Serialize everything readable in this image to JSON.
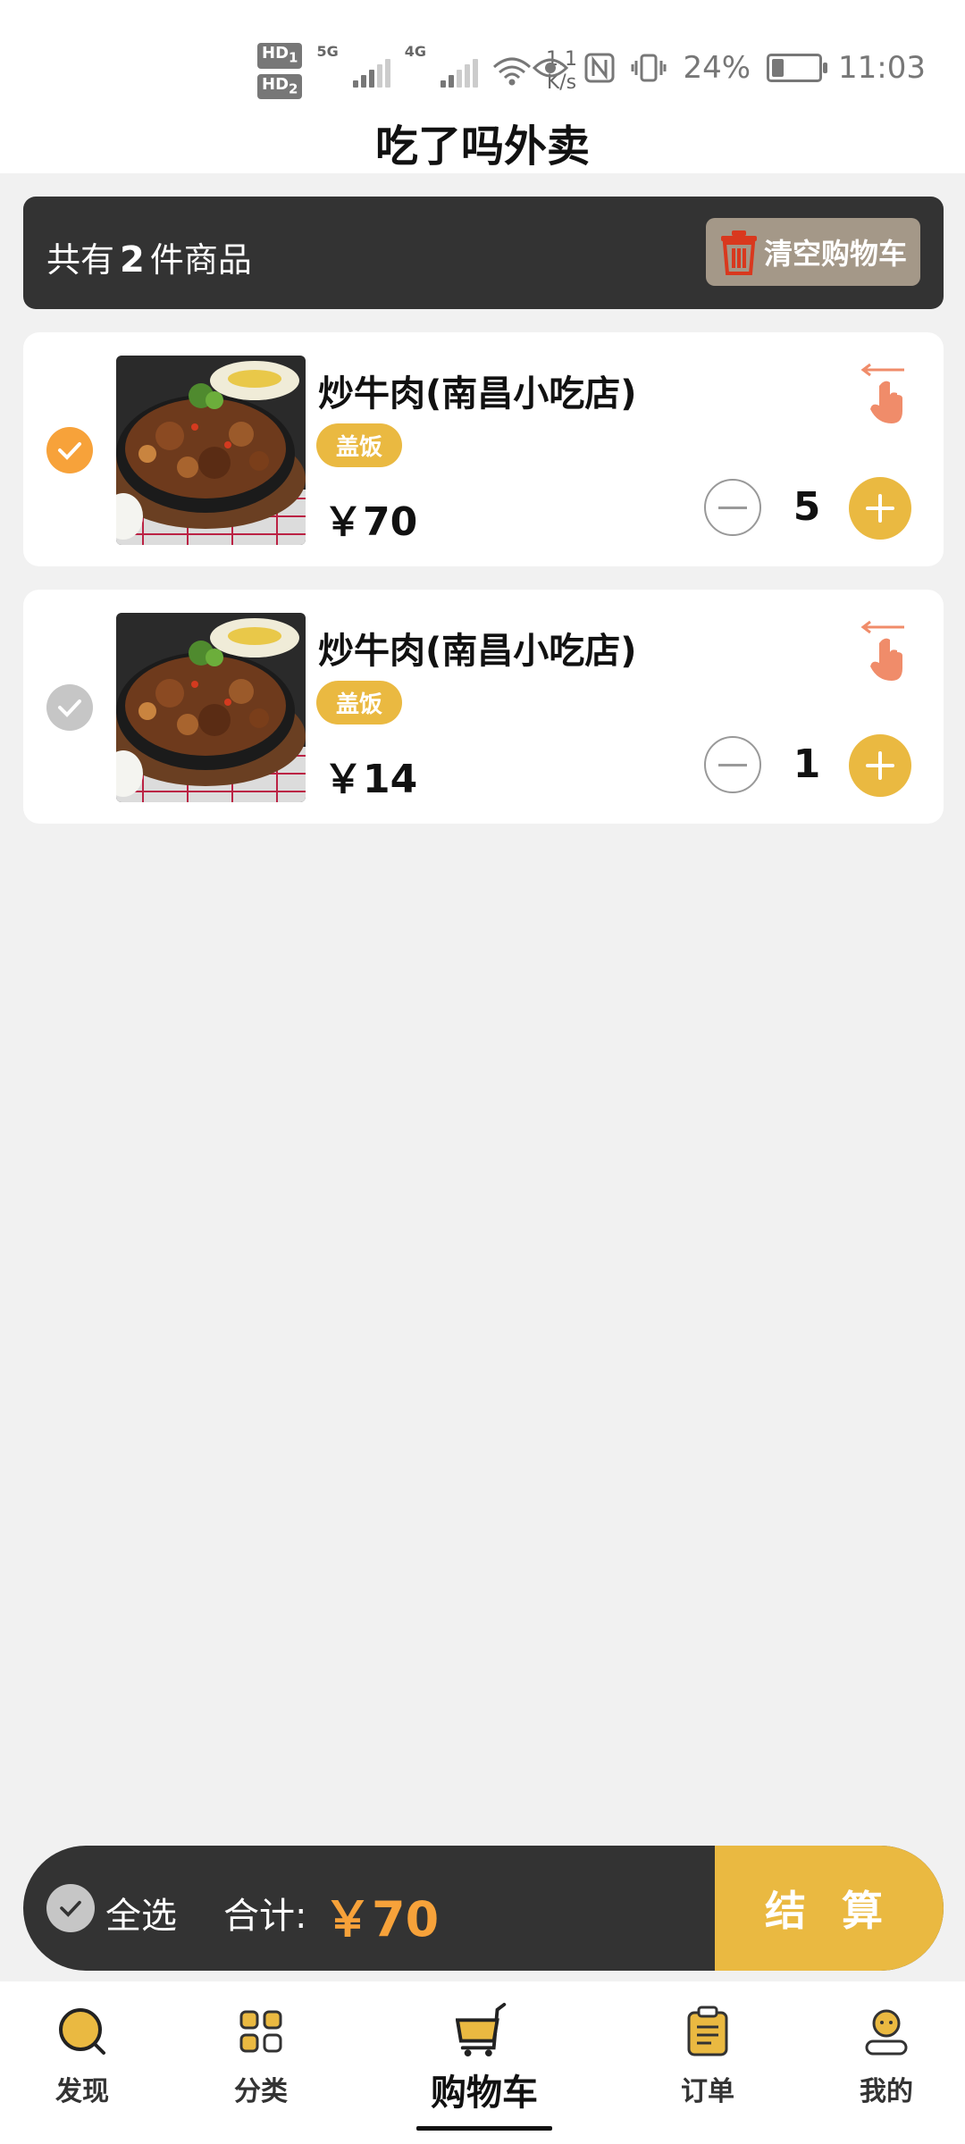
{
  "status_bar": {
    "hd1": "HD",
    "hd1_sub": "1",
    "hd2": "HD",
    "hd2_sub": "2",
    "net1": "5G",
    "net2": "4G",
    "speed_value": "1.1",
    "speed_unit": "K/s",
    "battery": "24%",
    "battery_level": 0.24,
    "time": "11:03"
  },
  "app": {
    "title": "吃了吗外卖"
  },
  "summary": {
    "prefix": "共有",
    "count": "2",
    "suffix": "件商品",
    "clear_label": "清空购物车"
  },
  "cart": {
    "items": [
      {
        "name": "炒牛肉(南昌小吃店)",
        "tag": "盖饭",
        "price": "￥70",
        "qty": "5",
        "checked": true
      },
      {
        "name": "炒牛肉(南昌小吃店)",
        "tag": "盖饭",
        "price": "￥14",
        "qty": "1",
        "checked": false
      }
    ]
  },
  "checkout": {
    "select_all": "全选",
    "total_label": "合计:",
    "total_value": "￥70",
    "submit": "结 算"
  },
  "tabs": [
    {
      "label": "发现",
      "icon": "discover-icon"
    },
    {
      "label": "分类",
      "icon": "category-icon"
    },
    {
      "label": "购物车",
      "icon": "cart-icon",
      "active": true
    },
    {
      "label": "订单",
      "icon": "order-icon"
    },
    {
      "label": "我的",
      "icon": "profile-icon"
    }
  ],
  "colors": {
    "accent_yellow": "#eab941",
    "accent_orange": "#f7a23a",
    "dark_bar": "#333333"
  }
}
